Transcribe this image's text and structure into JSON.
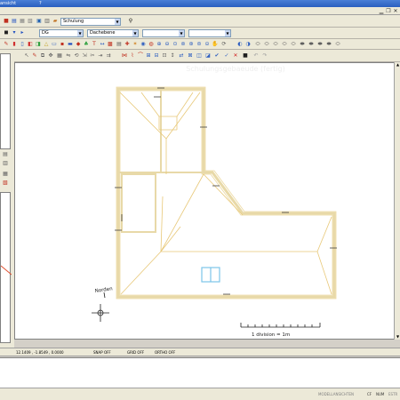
{
  "window": {
    "title_fragment": "ansicht",
    "help_mark": "?"
  },
  "toolbar": {
    "layer_combo": "Schulung",
    "style_combo": "DG",
    "element_combo": "Dachebene"
  },
  "drawing": {
    "watermark": "Schulungsgebaeude (fertig)",
    "north_label": "Norden",
    "scale_label": "1 division = 1m"
  },
  "status": {
    "coordinates": "12.1409 , -1.8549 , 0.0000",
    "snap": "SNAP OFF",
    "grid": "GRID OFF",
    "ortho": "ORTHO OFF"
  },
  "bottom": {
    "mode": "MODELLANSICHTEN",
    "caps": "CF",
    "num": "NUM",
    "extra": "ESTR"
  },
  "colors": {
    "wall": "#e8d9a8",
    "roof_line": "#e8c878",
    "window": "#7cc4e8",
    "path": "#e05030",
    "titlebar": "#2a5fbf"
  }
}
